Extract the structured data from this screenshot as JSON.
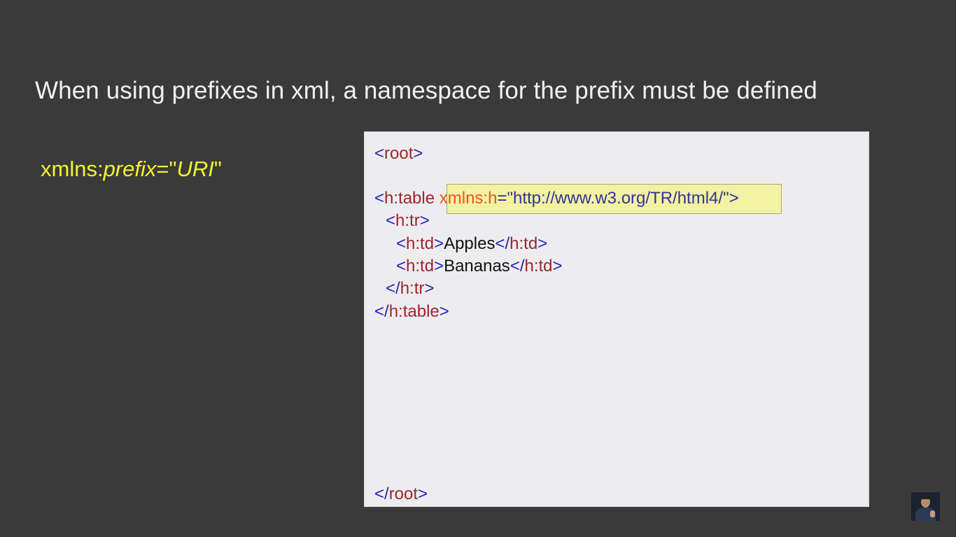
{
  "slide": {
    "title": "When using prefixes in xml, a namespace for the prefix must be defined",
    "syntax": {
      "part1": "xmlns:",
      "part2": "prefix",
      "part3": "=\"",
      "part4": "URI",
      "part5": "\""
    }
  },
  "code": {
    "root_open": {
      "lt": "<",
      "tag": "root",
      "gt": ">"
    },
    "table_open": {
      "lt": "<",
      "tag": "h:table",
      "space": " ",
      "attr_name": "xmlns:h",
      "eq": "=",
      "attr_value": "\"http://www.w3.org/TR/html4/\"",
      "gt": ">"
    },
    "tr_open": {
      "lt": "<",
      "tag": "h:tr",
      "gt": ">"
    },
    "td1": {
      "lt": "<",
      "tag": "h:td",
      "gt": ">",
      "text": "Apples",
      "lt2": "</",
      "tag2": "h:td",
      "gt2": ">"
    },
    "td2": {
      "lt": "<",
      "tag": "h:td",
      "gt": ">",
      "text": "Bananas",
      "lt2": "</",
      "tag2": "h:td",
      "gt2": ">"
    },
    "tr_close": {
      "lt": "</",
      "tag": "h:tr",
      "gt": ">"
    },
    "table_close": {
      "lt": "</",
      "tag": "h:table",
      "gt": ">"
    },
    "root_close": {
      "lt": "</",
      "tag": "root",
      "gt": ">"
    }
  },
  "colors": {
    "background": "#3a3a3a",
    "title": "#f0f0f0",
    "syntax": "#f2f230",
    "panel": "#ededf0",
    "bracket": "#2424b8",
    "tag": "#a3222e",
    "attribute_name": "#f0531c",
    "attribute_value": "#33339a",
    "highlight": "#f2f2a2"
  },
  "presenter": {
    "icon": "presenter-thumbnail-icon"
  }
}
